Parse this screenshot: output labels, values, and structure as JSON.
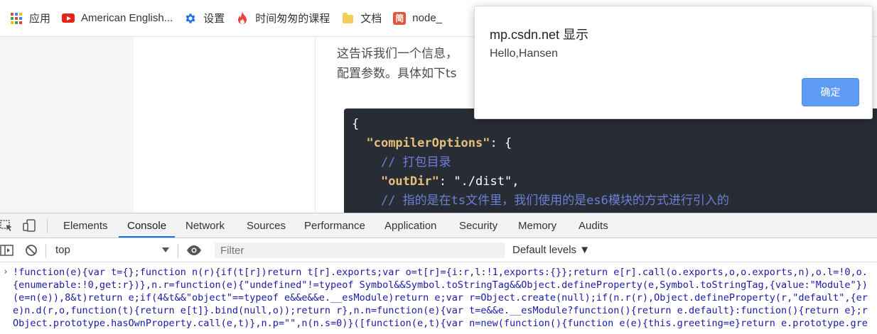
{
  "bookmarks": [
    {
      "label": "应用",
      "icon": "apps-grid-icon"
    },
    {
      "label": "American English...",
      "icon": "youtube-icon"
    },
    {
      "label": "设置",
      "icon": "gear-icon"
    },
    {
      "label": "时间匆匆的课程",
      "icon": "flame-icon"
    },
    {
      "label": "文档",
      "icon": "folder-icon"
    },
    {
      "label": "node_",
      "icon": "csdn-icon",
      "icon_text": "简"
    }
  ],
  "article": {
    "line1": "这告诉我们一个信息，",
    "line2": "配置参数。具体如下ts"
  },
  "code_lines": {
    "l1": "{",
    "l2_key": "\"compilerOptions\"",
    "l2_rest": ": {",
    "l3": "// 打包目录",
    "l4_key": "\"outDir\"",
    "l4_rest": ": \"./dist\",",
    "l5": "// 指的是在ts文件里，我们使用的是es6模块的方式进行引入的"
  },
  "dialog": {
    "title": "mp.csdn.net 显示",
    "message": "Hello,Hansen",
    "ok_label": "确定"
  },
  "devtools": {
    "tabs": [
      "Elements",
      "Console",
      "Network",
      "Sources",
      "Performance",
      "Application",
      "Security",
      "Memory",
      "Audits"
    ],
    "active_tab": "Console",
    "context": "top",
    "filter_placeholder": "Filter",
    "levels": "Default levels ▼",
    "console_lines": [
      "!function(e){var t={};function n(r){if(t[r])return t[r].exports;var o=t[r]={i:r,l:!1,exports:{}};return e[r].call(o.exports,o,o.exports,n),o.l=!0,o.",
      "{enumerable:!0,get:r})},n.r=function(e){\"undefined\"!=typeof Symbol&&Symbol.toStringTag&&Object.defineProperty(e,Symbol.toStringTag,{value:\"Module\"})",
      "(e=n(e)),8&t)return e;if(4&t&&\"object\"==typeof e&&e&&e.__esModule)return e;var r=Object.create(null);if(n.r(r),Object.defineProperty(r,\"default\",{er",
      "e)n.d(r,o,function(t){return e[t]}.bind(null,o));return r},n.n=function(e){var t=e&&e.__esModule?function(){return e.default}:function(){return e};r",
      "Object.prototype.hasOwnProperty.call(e,t)},n.p=\"\",n(n.s=0)}([function(e,t){var n=new(function(){function e(e){this.greeting=e}return e.prototype.gre"
    ]
  }
}
